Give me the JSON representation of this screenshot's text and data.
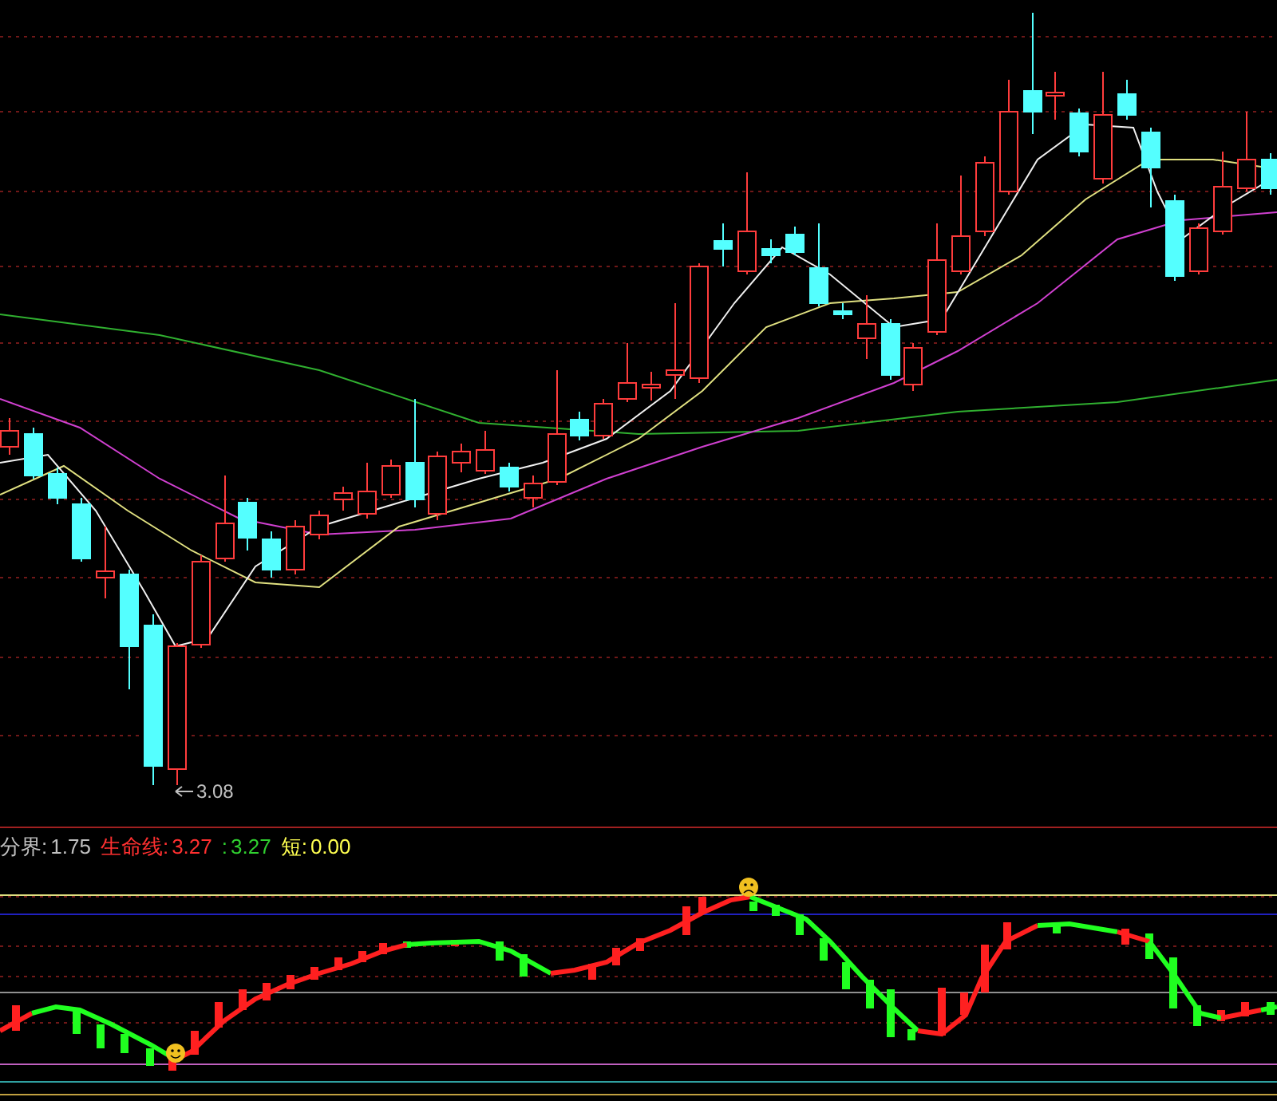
{
  "price_panel": {
    "low_marker": "3.08"
  },
  "indicator_legend": [
    {
      "label": "分界:",
      "value": "1.75",
      "color": "#c0c0c0"
    },
    {
      "label": "生命线:",
      "value": "3.27",
      "color": "#ff3030"
    },
    {
      "label": ":",
      "value": "3.27",
      "color": "#30d030"
    },
    {
      "label": "短:",
      "value": "0.00",
      "color": "#ffff50"
    }
  ]
}
